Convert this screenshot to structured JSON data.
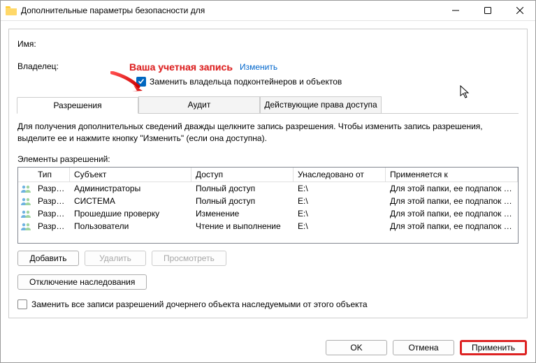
{
  "window": {
    "title": "Дополнительные параметры безопасности для"
  },
  "labels": {
    "name": "Имя:",
    "owner": "Владелец:",
    "change_link": "Изменить",
    "replace_owner": "Заменить владельца подконтейнеров и объектов",
    "desc": "Для получения дополнительных сведений дважды щелкните запись разрешения. Чтобы изменить запись разрешения, выделите ее и нажмите кнопку \"Изменить\" (если она доступна).",
    "perm_elements": "Элементы разрешений:",
    "replace_all": "Заменить все записи разрешений дочернего объекта наследуемыми от этого объекта"
  },
  "owner_name": "Ваша учетная запись",
  "tabs": [
    {
      "label": "Разрешения",
      "active": true
    },
    {
      "label": "Аудит",
      "active": false
    },
    {
      "label": "Действующие права доступа",
      "active": false
    }
  ],
  "columns": {
    "type": "Тип",
    "subject": "Субъект",
    "access": "Доступ",
    "inherited": "Унаследовано от",
    "applies": "Применяется к"
  },
  "rows": [
    {
      "type": "Разр…",
      "subject": "Администраторы",
      "access": "Полный доступ",
      "inherited": "E:\\",
      "applies": "Для этой папки, ее подпапок …"
    },
    {
      "type": "Разр…",
      "subject": "СИСТЕМА",
      "access": "Полный доступ",
      "inherited": "E:\\",
      "applies": "Для этой папки, ее подпапок …"
    },
    {
      "type": "Разр…",
      "subject": "Прошедшие проверку",
      "access": "Изменение",
      "inherited": "E:\\",
      "applies": "Для этой папки, ее подпапок …"
    },
    {
      "type": "Разр…",
      "subject": "Пользователи",
      "access": "Чтение и выполнение",
      "inherited": "E:\\",
      "applies": "Для этой папки, ее подпапок …"
    }
  ],
  "buttons": {
    "add": "Добавить",
    "remove": "Удалить",
    "view": "Просмотреть",
    "disable_inherit": "Отключение наследования",
    "ok": "OK",
    "cancel": "Отмена",
    "apply": "Применить"
  },
  "checks": {
    "replace_owner": true,
    "replace_all": false
  }
}
